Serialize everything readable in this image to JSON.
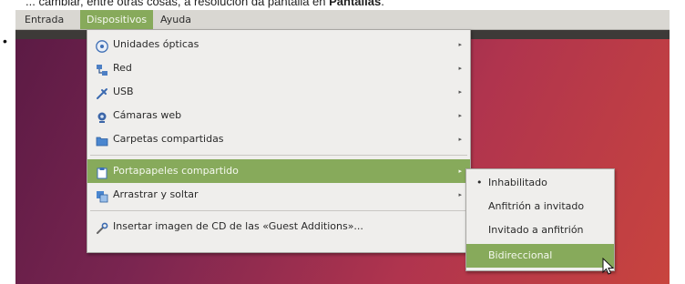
{
  "caption": {
    "prefix": "... cambiar, entre otras cosas, a resolución da pantalla en ",
    "bold": "Pantallas",
    "suffix": "."
  },
  "bullet": "•",
  "menubar": {
    "items": [
      "Entrada",
      "Dispositivos",
      "Ayuda"
    ]
  },
  "devices_menu": {
    "items": [
      {
        "label": "Unidades ópticas",
        "icon": "optical-drive-icon",
        "submenu": true
      },
      {
        "label": "Red",
        "icon": "network-icon",
        "submenu": true
      },
      {
        "label": "USB",
        "icon": "usb-icon",
        "submenu": true
      },
      {
        "label": "Cámaras web",
        "icon": "webcam-icon",
        "submenu": true
      },
      {
        "label": "Carpetas compartidas",
        "icon": "folder-icon",
        "submenu": true
      },
      {
        "label": "Portapapeles compartido",
        "icon": "clipboard-icon",
        "submenu": true,
        "highlighted": true
      },
      {
        "label": "Arrastrar y soltar",
        "icon": "drag-drop-icon",
        "submenu": true
      },
      {
        "label": "Insertar imagen de CD de las «Guest Additions»...",
        "icon": "wrench-icon",
        "submenu": false
      }
    ]
  },
  "clipboard_submenu": {
    "items": [
      {
        "label": "Inhabilitado",
        "selected": true
      },
      {
        "label": "Anfitrión a invitado",
        "selected": false
      },
      {
        "label": "Invitado a anfitrión",
        "selected": false
      },
      {
        "label": "Bidireccional",
        "selected": false,
        "highlighted": true
      }
    ],
    "selected_marker": "•"
  },
  "submenu_arrow": "▸",
  "colors": {
    "highlight": "#87aa5b",
    "menubar": "#d9d7d2",
    "menu_bg": "#efeeec"
  }
}
